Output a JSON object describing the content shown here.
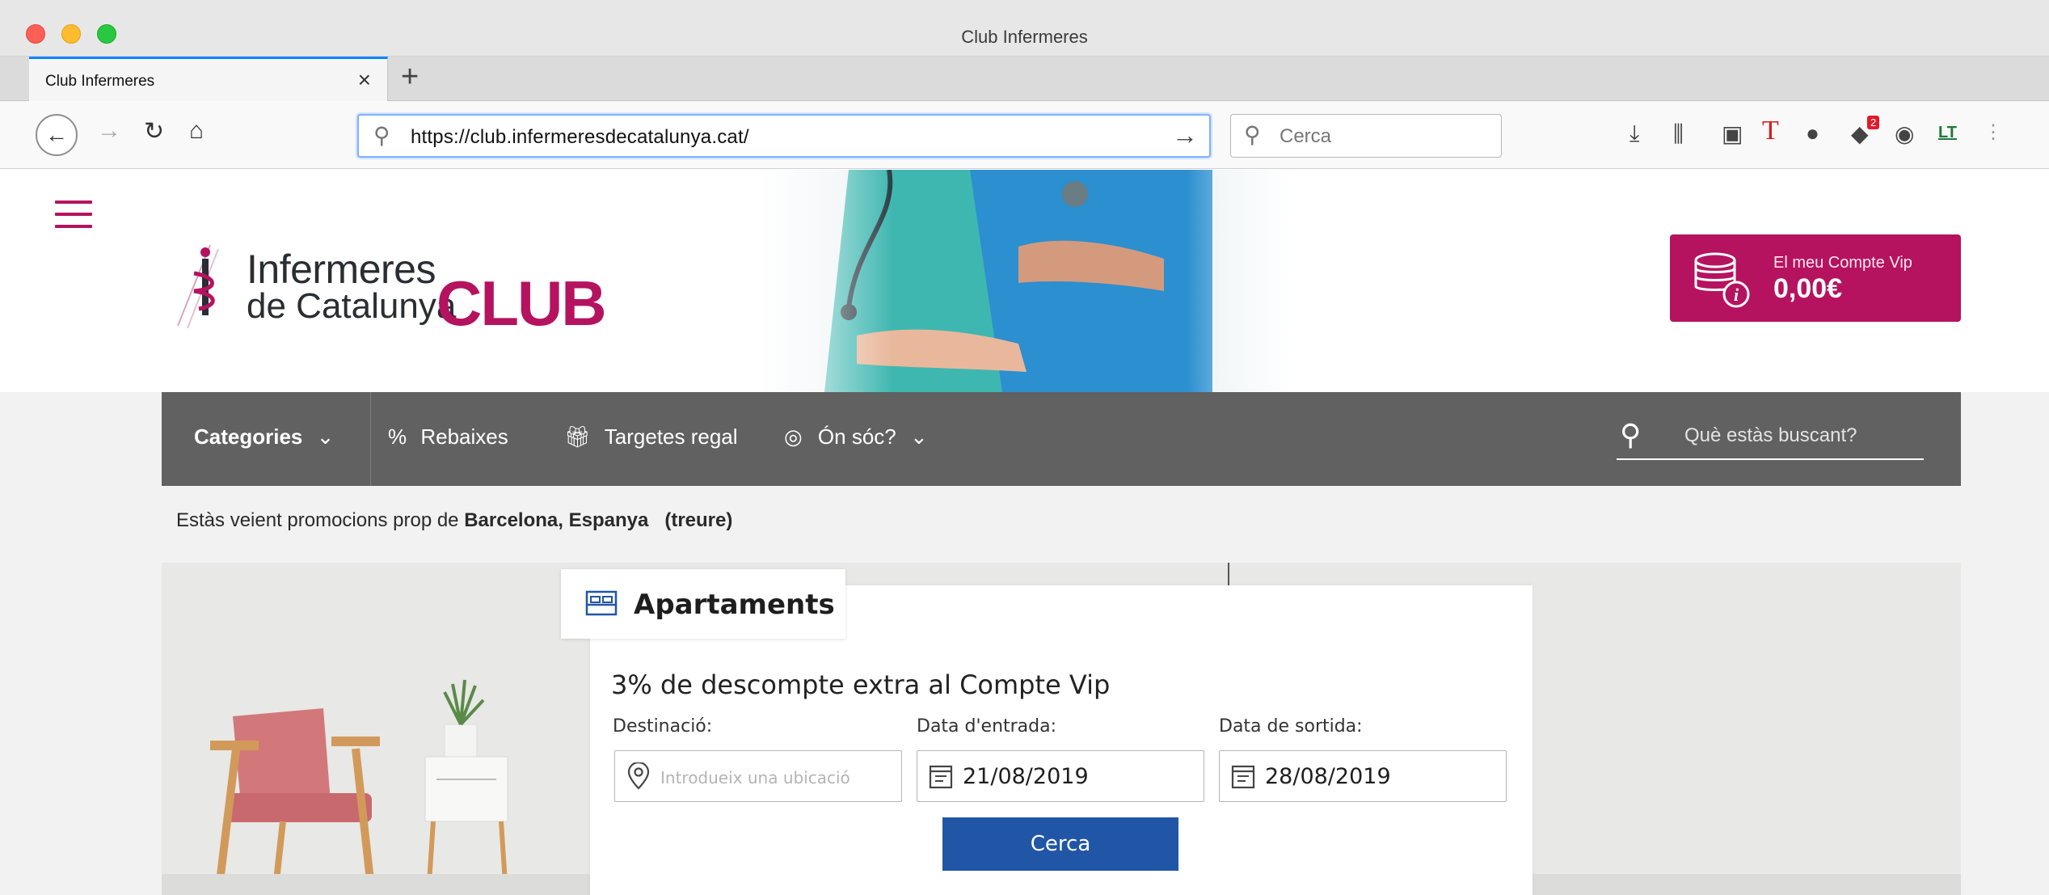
{
  "browser": {
    "window_title": "Club Infermeres",
    "tab_label": "Club Infermeres",
    "url": "https://club.infermeresdecatalunya.cat/",
    "search_placeholder": "Cerca",
    "extension_badge": "2",
    "extension_lt": "LT"
  },
  "header": {
    "logo_line1": "Infermeres",
    "logo_line2": "de Catalunya",
    "logo_club": "CLUB",
    "vip_label": "El meu Compte Vip",
    "vip_amount": "0,00€"
  },
  "nav": {
    "categories": "Categories",
    "rebaixes": "Rebaixes",
    "targetes_regal": "Targetes regal",
    "on_soc": "Ón sóc?",
    "search_placeholder": "Què estàs buscant?"
  },
  "location": {
    "prefix": "Estàs veient promocions prop de",
    "place": "Barcelona, Espanya",
    "remove": "(treure)"
  },
  "booking": {
    "tab_label": "Apartaments",
    "promo": "3% de descompte extra al Compte Vip",
    "destination_label": "Destinació:",
    "destination_placeholder": "Introdueix una ubicació",
    "checkin_label": "Data d'entrada:",
    "checkin_value": "21/08/2019",
    "checkout_label": "Data de sortida:",
    "checkout_value": "28/08/2019",
    "search_button": "Cerca"
  },
  "colors": {
    "brand": "#b5135f",
    "nav_bg": "#616161",
    "button": "#2156a6"
  },
  "icons": [
    "back-icon",
    "forward-icon",
    "reload-icon",
    "home-icon",
    "search-icon",
    "go-arrow-icon",
    "download-icon",
    "library-icon",
    "reader-icon",
    "hamburger-icon",
    "coins-icon",
    "chevron-down-icon",
    "percent-icon",
    "gift-icon",
    "location-pin-icon",
    "bed-icon",
    "calendar-icon"
  ]
}
